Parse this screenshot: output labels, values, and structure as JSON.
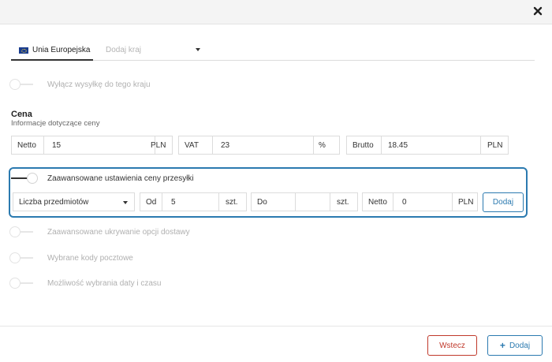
{
  "tabs": {
    "active": "Unia Europejska",
    "add_country": "Dodaj kraj"
  },
  "toggles": {
    "disable_shipping": "Wyłącz wysyłkę do tego kraju",
    "advanced_price": "Zaawansowane ustawienia ceny przesyłki",
    "advanced_hiding": "Zaawansowane ukrywanie opcji dostawy",
    "postal_codes": "Wybrane kody pocztowe",
    "date_time": "Możliwość wybrania daty i czasu"
  },
  "price": {
    "title": "Cena",
    "subtitle": "Informacje dotyczące ceny",
    "netto_label": "Netto",
    "netto_value": "15",
    "netto_unit": "PLN",
    "vat_label": "VAT",
    "vat_value": "23",
    "vat_unit": "%",
    "brutto_label": "Brutto",
    "brutto_value": "18.45",
    "brutto_unit": "PLN"
  },
  "advanced": {
    "select_value": "Liczba przedmiotów",
    "from_label": "Od",
    "from_value": "5",
    "from_unit": "szt.",
    "to_label": "Do",
    "to_value": "",
    "to_unit": "szt.",
    "netto_label": "Netto",
    "netto_value": "0",
    "netto_unit": "PLN",
    "add_button": "Dodaj"
  },
  "footer": {
    "back_button": "Wstecz",
    "add_button": "Dodaj"
  },
  "colors": {
    "accent": "#2b7ab0",
    "danger": "#c0392b"
  },
  "icons": [
    "close-icon",
    "eu-flag-icon",
    "chevron-down-icon",
    "plus-icon"
  ]
}
